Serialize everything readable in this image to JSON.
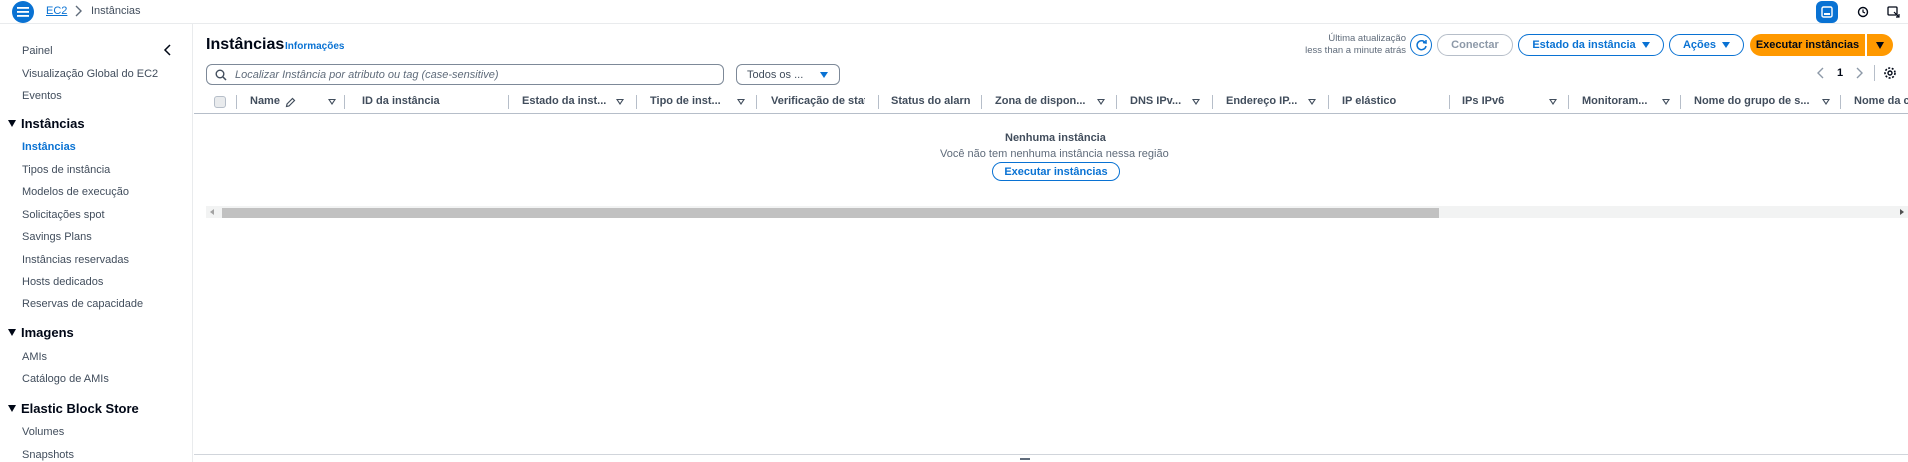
{
  "breadcrumb": {
    "service": "EC2",
    "current": "Instâncias"
  },
  "sidebar": {
    "top_items": [
      "Painel",
      "Visualização Global do EC2",
      "Eventos"
    ],
    "sections": [
      {
        "title": "Instâncias",
        "items": [
          "Instâncias",
          "Tipos de instância",
          "Modelos de execução",
          "Solicitações spot",
          "Savings Plans",
          "Instâncias reservadas",
          "Hosts dedicados",
          "Reservas de capacidade"
        ]
      },
      {
        "title": "Imagens",
        "items": [
          "AMIs",
          "Catálogo de AMIs"
        ]
      },
      {
        "title": "Elastic Block Store",
        "items": [
          "Volumes",
          "Snapshots"
        ]
      }
    ],
    "active_item": "Instâncias"
  },
  "header": {
    "title": "Instâncias",
    "info_link": "Informações",
    "last_update_label": "Última atualização",
    "last_update_value": "less than a minute atrás",
    "buttons": {
      "connect": "Conectar",
      "instance_state": "Estado da instância",
      "actions": "Ações",
      "launch": "Executar instâncias"
    }
  },
  "filter": {
    "search_placeholder": "Localizar Instância por atributo ou tag (case-sensitive)",
    "state_select": "Todos os ..."
  },
  "pagination": {
    "current_page": "1"
  },
  "table": {
    "columns": [
      "Name",
      "ID da instância",
      "Estado da inst...",
      "Tipo de inst...",
      "Verificação de stat",
      "Status do alarn",
      "Zona de dispon...",
      "DNS IPv...",
      "Endereço IP...",
      "IP elástico",
      "IPs IPv6",
      "Monitoram...",
      "Nome do grupo de s...",
      "Nome da c"
    ],
    "rows": []
  },
  "empty_state": {
    "title": "Nenhuma instância",
    "description": "Você não tem nenhuma instância nessa região",
    "button": "Executar instâncias"
  },
  "colors": {
    "accent": "#0972d3",
    "primary_button": "#ff9900",
    "text": "#000716",
    "muted": "#414d5c"
  }
}
